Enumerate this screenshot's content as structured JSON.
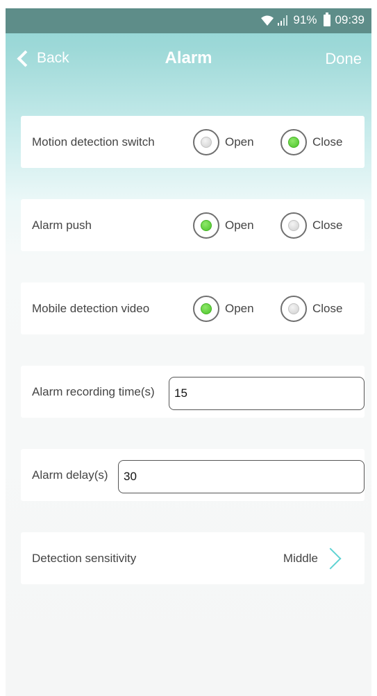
{
  "status_bar": {
    "battery": "91%",
    "time": "09:39"
  },
  "nav": {
    "back_label": "Back",
    "title": "Alarm",
    "done_label": "Done"
  },
  "motion_detection": {
    "label": "Motion detection switch",
    "open_label": "Open",
    "close_label": "Close",
    "selected": "Close"
  },
  "alarm_push": {
    "label": "Alarm push",
    "open_label": "Open",
    "close_label": "Close",
    "selected": "Open"
  },
  "mobile_detection_video": {
    "label": "Mobile detection video",
    "open_label": "Open",
    "close_label": "Close",
    "selected": "Open"
  },
  "alarm_recording_time": {
    "label": "Alarm recording time(s)",
    "value": "15"
  },
  "alarm_delay": {
    "label": "Alarm delay(s)",
    "value": "30"
  },
  "detection_sensitivity": {
    "label": "Detection sensitivity",
    "value": "Middle"
  },
  "colors": {
    "accent": "#5fd3d3",
    "selected_radio": "#4cc42a",
    "status_bar": "#5e8d89"
  }
}
